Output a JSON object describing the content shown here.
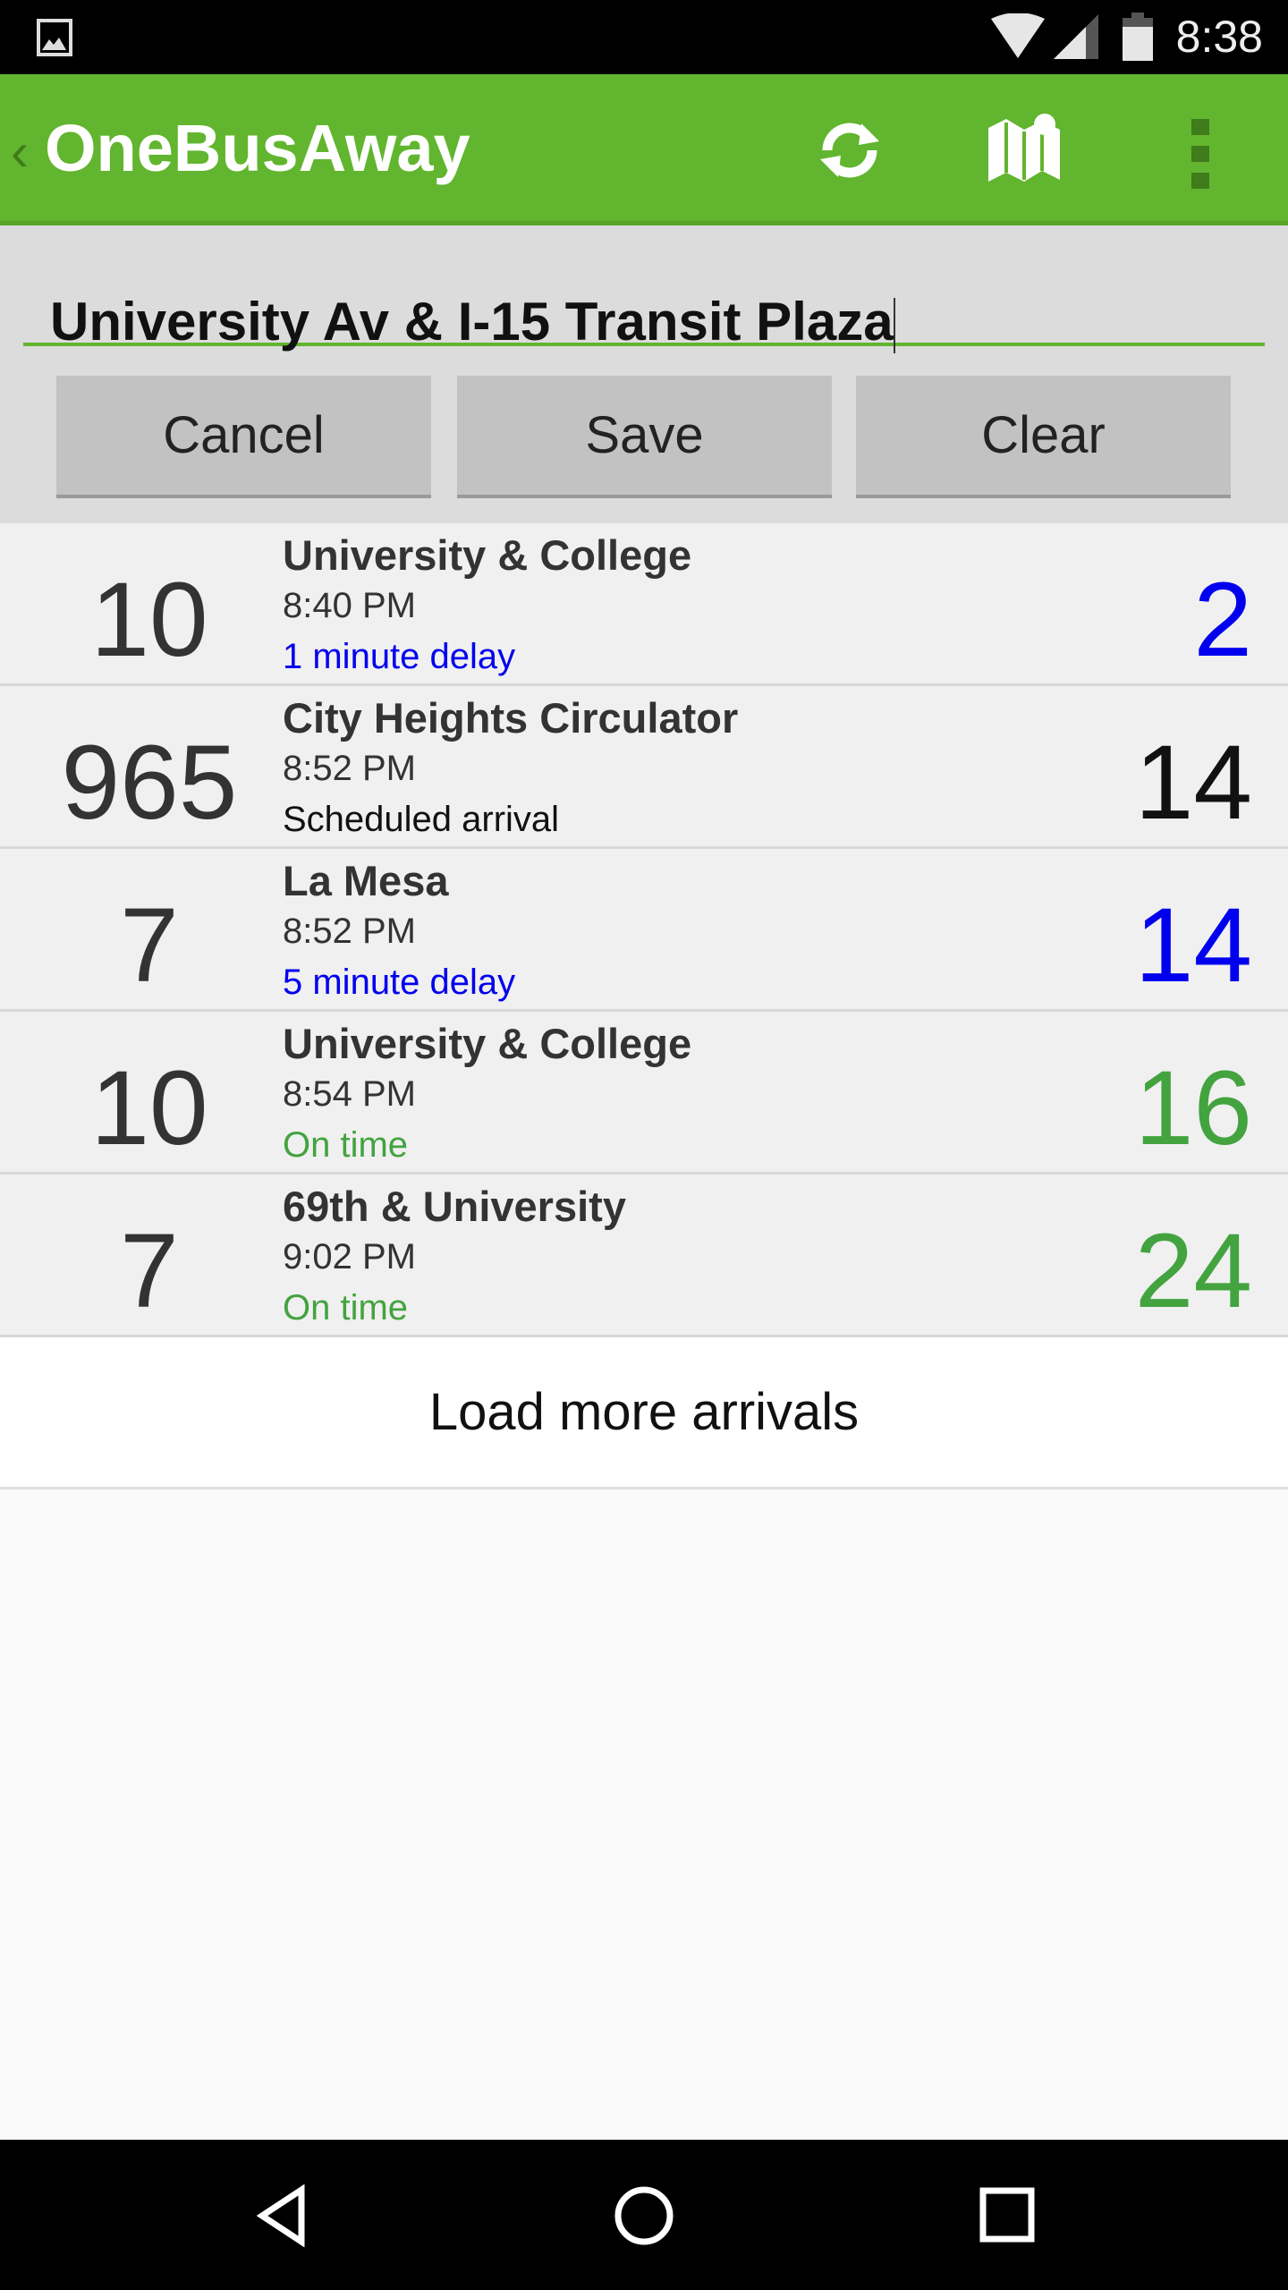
{
  "status_bar": {
    "time": "8:38",
    "icons": [
      "image-notification-icon",
      "wifi-icon",
      "cell-signal-icon",
      "battery-icon"
    ]
  },
  "action_bar": {
    "title": "OneBusAway",
    "icons": [
      "back-chevron-icon",
      "refresh-icon",
      "map-icon",
      "overflow-menu-icon"
    ],
    "color": "#62b52e"
  },
  "search": {
    "value": "University Av & I-15 Transit Plaza",
    "buttons": {
      "cancel": "Cancel",
      "save": "Save",
      "clear": "Clear"
    }
  },
  "arrivals": [
    {
      "route": "10",
      "destination": "University & College",
      "time": "8:40 PM",
      "status": "1 minute delay",
      "minutes": "2",
      "color": "#0000ee"
    },
    {
      "route": "965",
      "destination": "City Heights Circulator",
      "time": "8:52 PM",
      "status": "Scheduled arrival",
      "minutes": "14",
      "color": "#111111"
    },
    {
      "route": "7",
      "destination": "La Mesa",
      "time": "8:52 PM",
      "status": "5 minute delay",
      "minutes": "14",
      "color": "#0000ee"
    },
    {
      "route": "10",
      "destination": "University & College",
      "time": "8:54 PM",
      "status": "On time",
      "minutes": "16",
      "color": "#43a33f"
    },
    {
      "route": "7",
      "destination": "69th & University",
      "time": "9:02 PM",
      "status": "On time",
      "minutes": "24",
      "color": "#43a33f"
    }
  ],
  "load_more": "Load more arrivals",
  "nav_bar": {
    "icons": [
      "back-icon",
      "home-icon",
      "recents-icon"
    ]
  }
}
